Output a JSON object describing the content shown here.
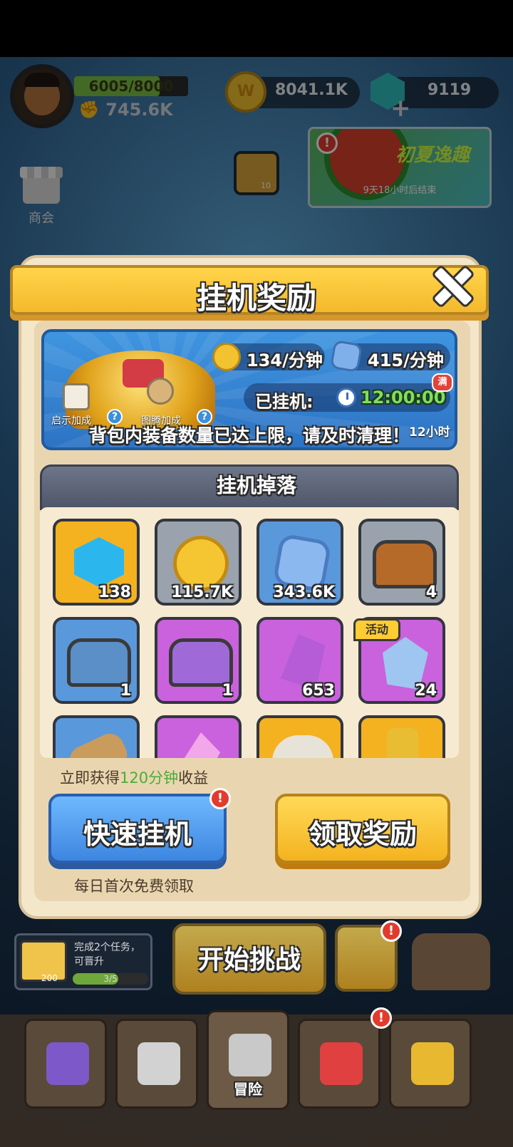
{
  "hud": {
    "exp_text": "6005/8000",
    "exp_progress": 0.75,
    "power": "745.6K",
    "coins": "8041.1K",
    "gems": "9119"
  },
  "side": {
    "shop_label": "商会",
    "scroll_count": "10"
  },
  "event_banner": {
    "title": "初夏逸趣",
    "subtitle": "9天18小时后结束"
  },
  "dialog": {
    "title": "挂机奖励",
    "rates": {
      "coin_rate": "134/分钟",
      "stone_rate": "415/分钟"
    },
    "idle": {
      "label": "已挂机:",
      "time": "12:00:00",
      "full_badge": "满",
      "limit": "12小时"
    },
    "bonuses": [
      {
        "label": "启示加成",
        "icon": "scroll-icon"
      },
      {
        "label": "图腾加成",
        "icon": "totem-icon"
      }
    ],
    "bag_full_notice": "背包内装备数量已达上限，请及时清理！",
    "drops_title": "挂机掉落",
    "items": [
      {
        "icon": "blue-gem-icon",
        "count": "138",
        "bg": "#f4b220"
      },
      {
        "icon": "gold-coin-icon",
        "count": "115.7K",
        "bg": "#9aa3ad"
      },
      {
        "icon": "spiral-stone-icon",
        "count": "343.6K",
        "bg": "#5a98dc"
      },
      {
        "icon": "wooden-chest-icon",
        "count": "4",
        "bg": "#9aa3ad"
      },
      {
        "icon": "steel-chest-icon",
        "count": "1",
        "bg": "#5a98dc"
      },
      {
        "icon": "purple-chest-icon",
        "count": "1",
        "bg": "#c962dc"
      },
      {
        "icon": "purple-crystal-icon",
        "count": "653",
        "bg": "#c962dc"
      },
      {
        "icon": "ice-crystal-icon",
        "count": "24",
        "bg": "#c962dc",
        "tag": "活动"
      },
      {
        "icon": "wood-log-icon",
        "count": "",
        "bg": "#5a98dc"
      },
      {
        "icon": "pink-shard-icon",
        "count": "",
        "bg": "#c962dc"
      },
      {
        "icon": "horn-helmet-icon",
        "count": "",
        "bg": "#f4b220"
      },
      {
        "icon": "golden-key-icon",
        "count": "",
        "bg": "#f4b220"
      }
    ],
    "instant_prefix": "立即获得",
    "instant_highlight": "120分钟",
    "instant_suffix": "收益",
    "quick_idle_button": "快速挂机",
    "claim_button": "领取奖励",
    "daily_free": "每日首次免费领取"
  },
  "bottom": {
    "quest_text": "完成2个任务，可晋升",
    "quest_reward": "200",
    "quest_progress_text": "3/5",
    "quest_progress": 0.6,
    "start_button": "开始挑战",
    "tabs": [
      {
        "icon": "sword-scroll-icon",
        "label": ""
      },
      {
        "icon": "viking-helmet-icon",
        "label": ""
      },
      {
        "icon": "crossed-swords-icon",
        "label": "冒险"
      },
      {
        "icon": "target-icon",
        "label": ""
      },
      {
        "icon": "trophy-icon",
        "label": ""
      }
    ]
  }
}
